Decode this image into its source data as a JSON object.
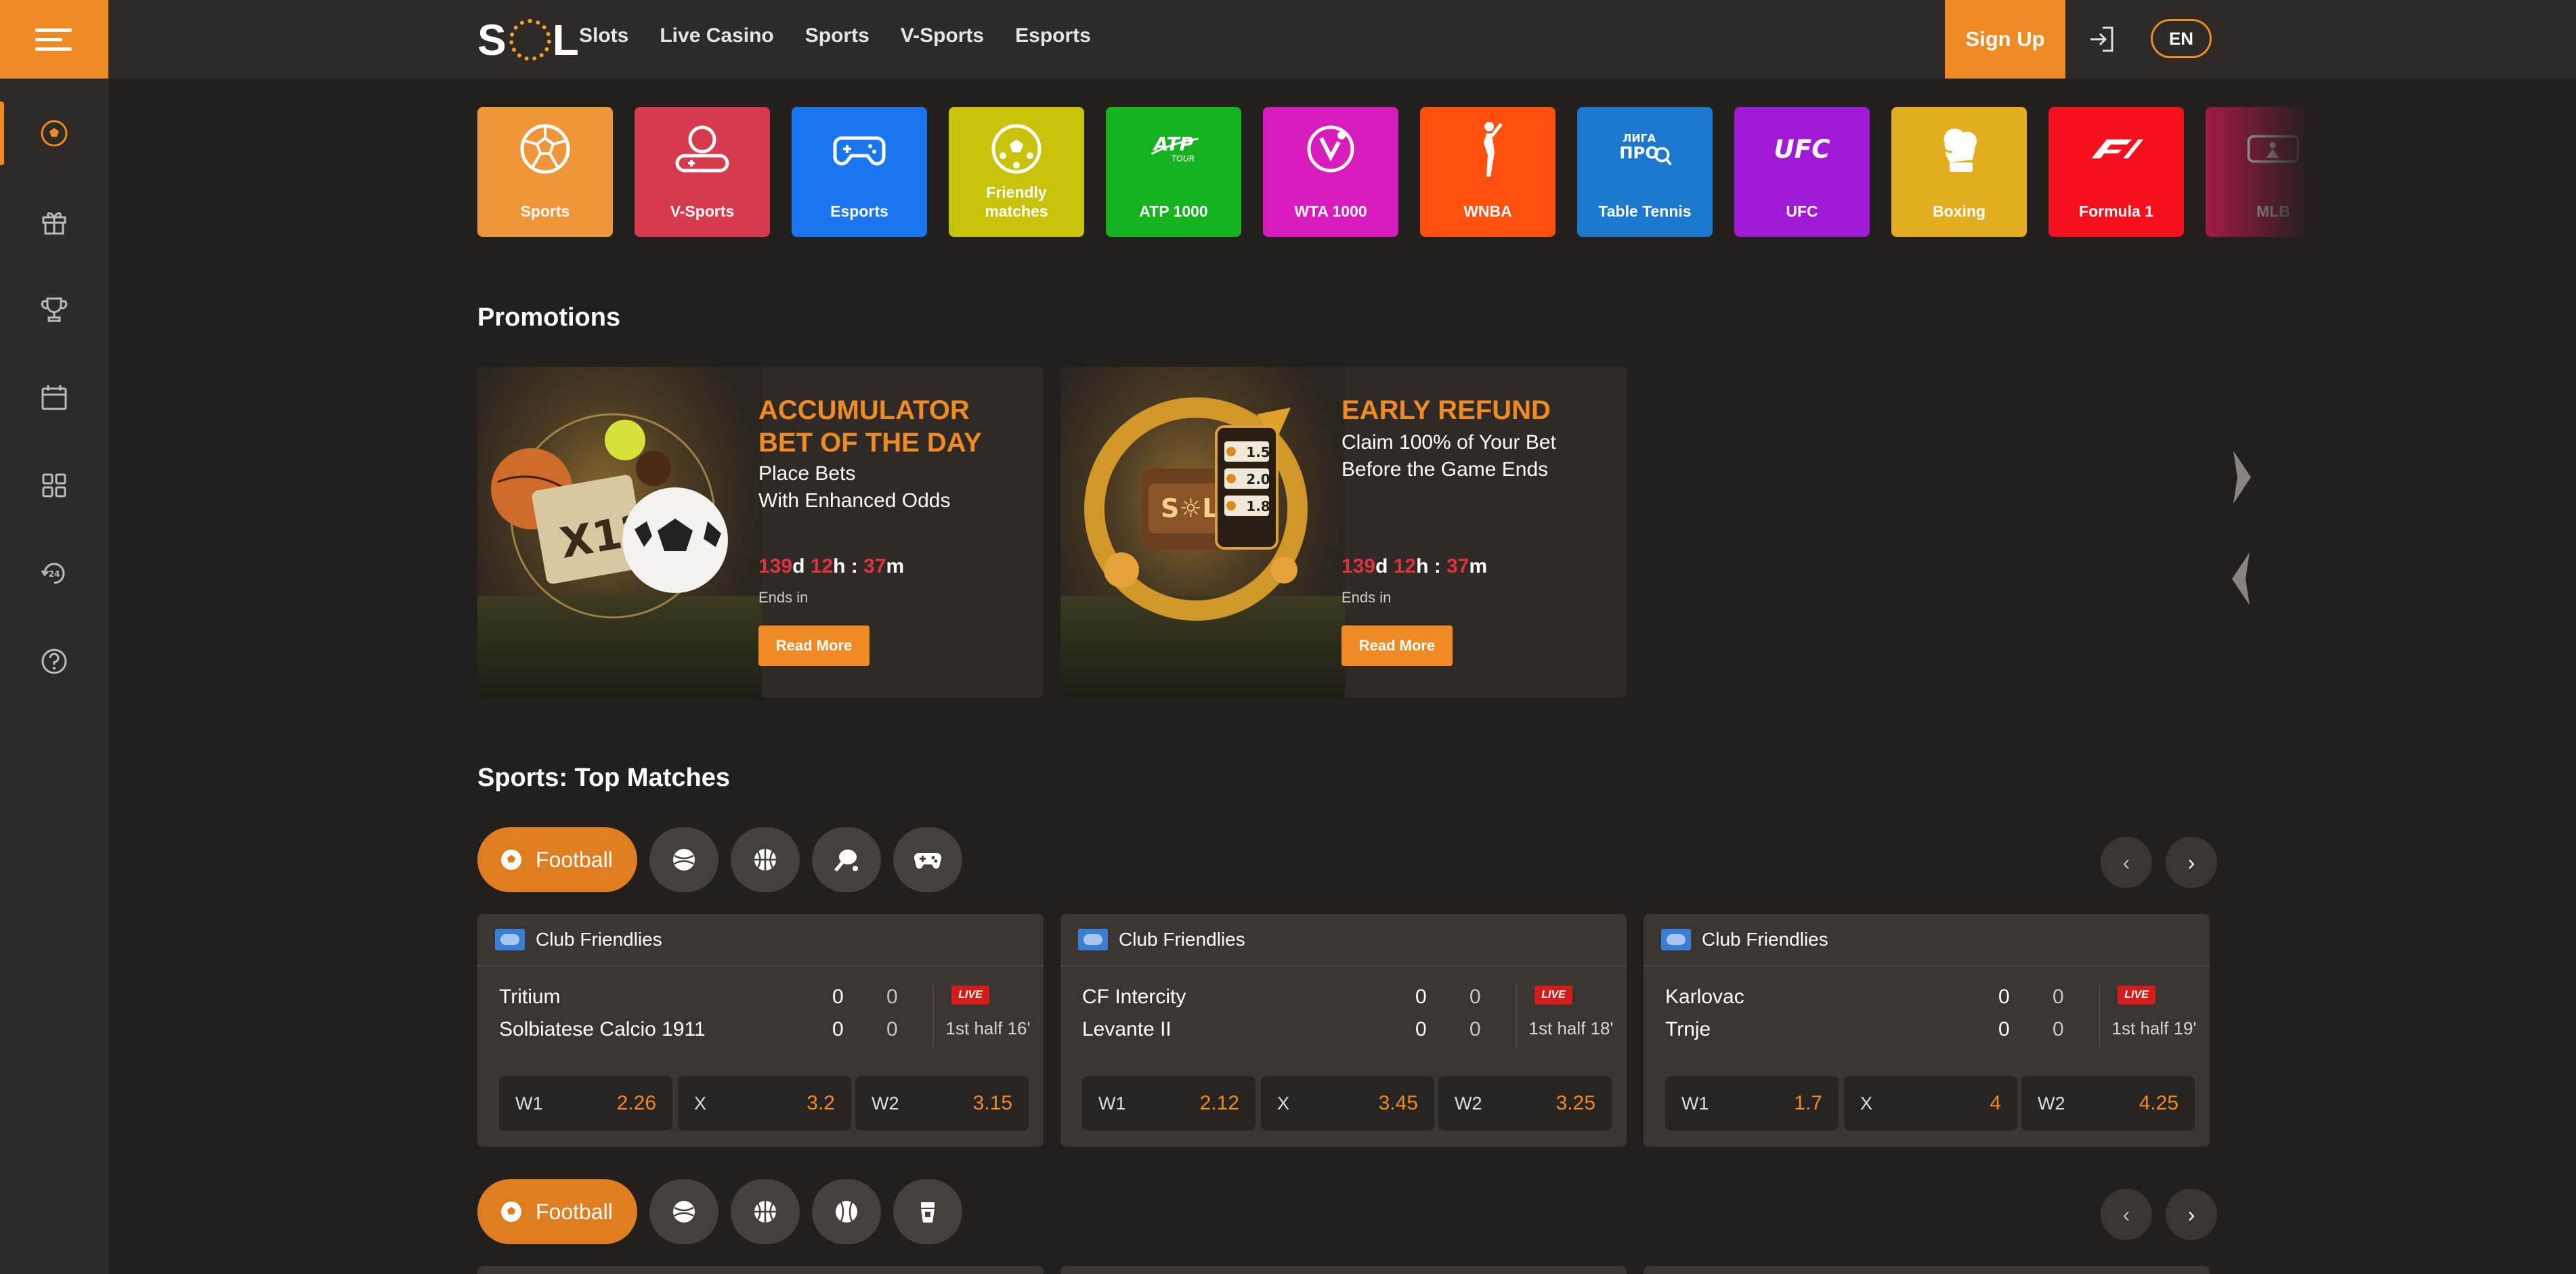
{
  "header": {
    "logo_text": "SOL",
    "nav": [
      "Slots",
      "Live Casino",
      "Sports",
      "V-Sports",
      "Esports"
    ],
    "signup_label": "Sign Up",
    "lang_label": "EN"
  },
  "sidebar": {
    "items": [
      "football-icon",
      "gift-icon",
      "trophy-icon",
      "calendar-icon",
      "grid-icon",
      "support-24-icon",
      "help-icon"
    ]
  },
  "categories": [
    {
      "label": "Sports",
      "color": "#f0963a",
      "icon": "soccer-ball-icon"
    },
    {
      "label": "V-Sports",
      "color": "#d63a4c",
      "icon": "vsports-icon"
    },
    {
      "label": "Esports",
      "color": "#1976f0",
      "icon": "gamepad-icon"
    },
    {
      "label": "Friendly matches",
      "color": "#c9c20a",
      "icon": "friendly-ball-icon"
    },
    {
      "label": "ATP 1000",
      "color": "#15b21f",
      "icon": "atp-icon"
    },
    {
      "label": "WTA 1000",
      "color": "#d91bbb",
      "icon": "wta-icon"
    },
    {
      "label": "WNBA",
      "color": "#ff5010",
      "icon": "wnba-icon"
    },
    {
      "label": "Table Tennis",
      "color": "#1b78cd",
      "icon": "table-tennis-icon"
    },
    {
      "label": "UFC",
      "color": "#a01ad6",
      "icon": "ufc-icon"
    },
    {
      "label": "Boxing",
      "color": "#e3ad22",
      "icon": "boxing-glove-icon"
    },
    {
      "label": "Formula 1",
      "color": "#f5101e",
      "icon": "f1-icon"
    },
    {
      "label": "MLB",
      "color": "#c21a48",
      "icon": "mlb-icon"
    }
  ],
  "promotions": {
    "title": "Promotions",
    "cards": [
      {
        "title": "ACCUMULATOR BET OF THE DAY",
        "desc_line1": "Place Bets",
        "desc_line2": "With Enhanced Odds",
        "days": "139",
        "hours": "12",
        "minutes": "37",
        "ends_label": "Ends in",
        "button": "Read More"
      },
      {
        "title": "EARLY REFUND",
        "desc_line1": "Claim 100% of Your Bet",
        "desc_line2": "Before the Game Ends",
        "days": "139",
        "hours": "12",
        "minutes": "37",
        "ends_label": "Ends in",
        "button": "Read More"
      }
    ]
  },
  "top_matches": {
    "title": "Sports: Top Matches",
    "active_tab": "Football",
    "tabs_row1": [
      "football-icon",
      "baseball-icon",
      "basketball-icon",
      "tennis-icon",
      "gamepad-icon"
    ],
    "tabs_row2": [
      "football-icon",
      "baseball-icon",
      "basketball-icon",
      "baseball-ball-icon",
      "drink-icon"
    ],
    "matches": [
      {
        "league": "Club Friendlies",
        "team1": "Tritium",
        "team2": "Solbiatese Calcio 1911",
        "t1_s1": "0",
        "t1_s2": "0",
        "t2_s1": "0",
        "t2_s2": "0",
        "live": "LIVE",
        "time": "1st half 16'",
        "odds": [
          {
            "label": "W1",
            "value": "2.26"
          },
          {
            "label": "X",
            "value": "3.2"
          },
          {
            "label": "W2",
            "value": "3.15"
          }
        ]
      },
      {
        "league": "Club Friendlies",
        "team1": "CF Intercity",
        "team2": "Levante II",
        "t1_s1": "0",
        "t1_s2": "0",
        "t2_s1": "0",
        "t2_s2": "0",
        "live": "LIVE",
        "time": "1st half 18'",
        "odds": [
          {
            "label": "W1",
            "value": "2.12"
          },
          {
            "label": "X",
            "value": "3.45"
          },
          {
            "label": "W2",
            "value": "3.25"
          }
        ]
      },
      {
        "league": "Club Friendlies",
        "team1": "Karlovac",
        "team2": "Trnje",
        "t1_s1": "0",
        "t1_s2": "0",
        "t2_s1": "0",
        "t2_s2": "0",
        "live": "LIVE",
        "time": "1st half 19'",
        "odds": [
          {
            "label": "W1",
            "value": "1.7"
          },
          {
            "label": "X",
            "value": "4"
          },
          {
            "label": "W2",
            "value": "4.25"
          }
        ]
      }
    ],
    "prev": "‹",
    "next": "›"
  }
}
